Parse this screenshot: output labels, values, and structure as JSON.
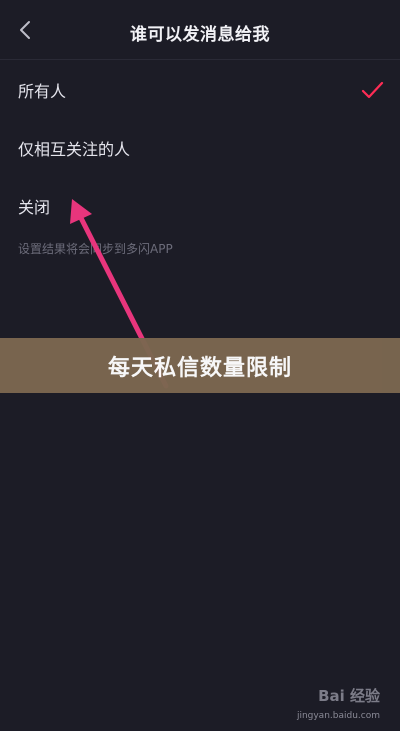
{
  "header": {
    "title": "谁可以发消息给我",
    "back_icon": "chevron-left-icon"
  },
  "options": [
    {
      "label": "所有人",
      "selected": true
    },
    {
      "label": "仅相互关注的人",
      "selected": false
    },
    {
      "label": "关闭",
      "selected": false
    }
  ],
  "hint": "设置结果将会同步到多闪APP",
  "banner": {
    "text": "每天私信数量限制"
  },
  "watermark": {
    "logo": "Bai 经验",
    "url": "jingyan.baidu.com"
  },
  "colors": {
    "background": "#1c1c26",
    "accent": "#fe2c55",
    "arrow": "#e8357c",
    "banner": "#7b6750"
  }
}
